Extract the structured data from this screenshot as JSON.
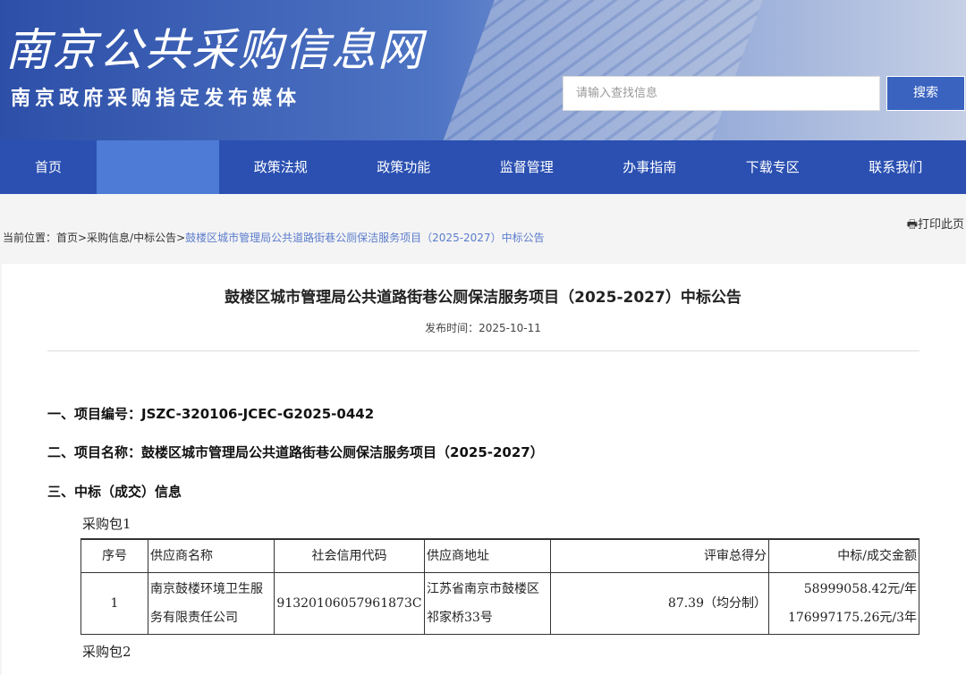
{
  "header": {
    "logo_text": "南京公共采购信息网",
    "slogan": "南京政府采购指定发布媒体",
    "search_placeholder": "请输入查找信息",
    "search_button": "搜索"
  },
  "nav": [
    "首页",
    "",
    "政策法规",
    "政策功能",
    "监督管理",
    "办事指南",
    "下载专区",
    "联系我们"
  ],
  "print_label": "打印此页",
  "breadcrumb": {
    "prefix": "当前位置：首页>采购信息/中标公告>",
    "current": "鼓楼区城市管理局公共道路街巷公厕保洁服务项目（2025-2027）中标公告"
  },
  "article": {
    "title": "鼓楼区城市管理局公共道路街巷公厕保洁服务项目（2025-2027）中标公告",
    "date": "发布时间：2025-10-11",
    "sections": [
      "一、项目编号：JSZC-320106-JCEC-G2025-0442",
      "二、项目名称：鼓楼区城市管理局公共道路街巷公厕保洁服务项目（2025-2027）",
      "三、中标（成交）信息"
    ],
    "packages": [
      "采购包1",
      "采购包2"
    ],
    "table": {
      "headers": [
        "序号",
        "供应商名称",
        "社会信用代码",
        "供应商地址",
        "评审总得分",
        "中标/成交金额"
      ],
      "rows": [
        {
          "no": "1",
          "name": "南京鼓楼环境卫生服务有限责任公司",
          "code": "91320106057961873C",
          "address": "江苏省南京市鼓楼区祁家桥33号",
          "score": "87.39（均分制）",
          "amount_year": "58999058.42元/年",
          "amount_total": "176997175.26元/3年"
        }
      ]
    }
  }
}
